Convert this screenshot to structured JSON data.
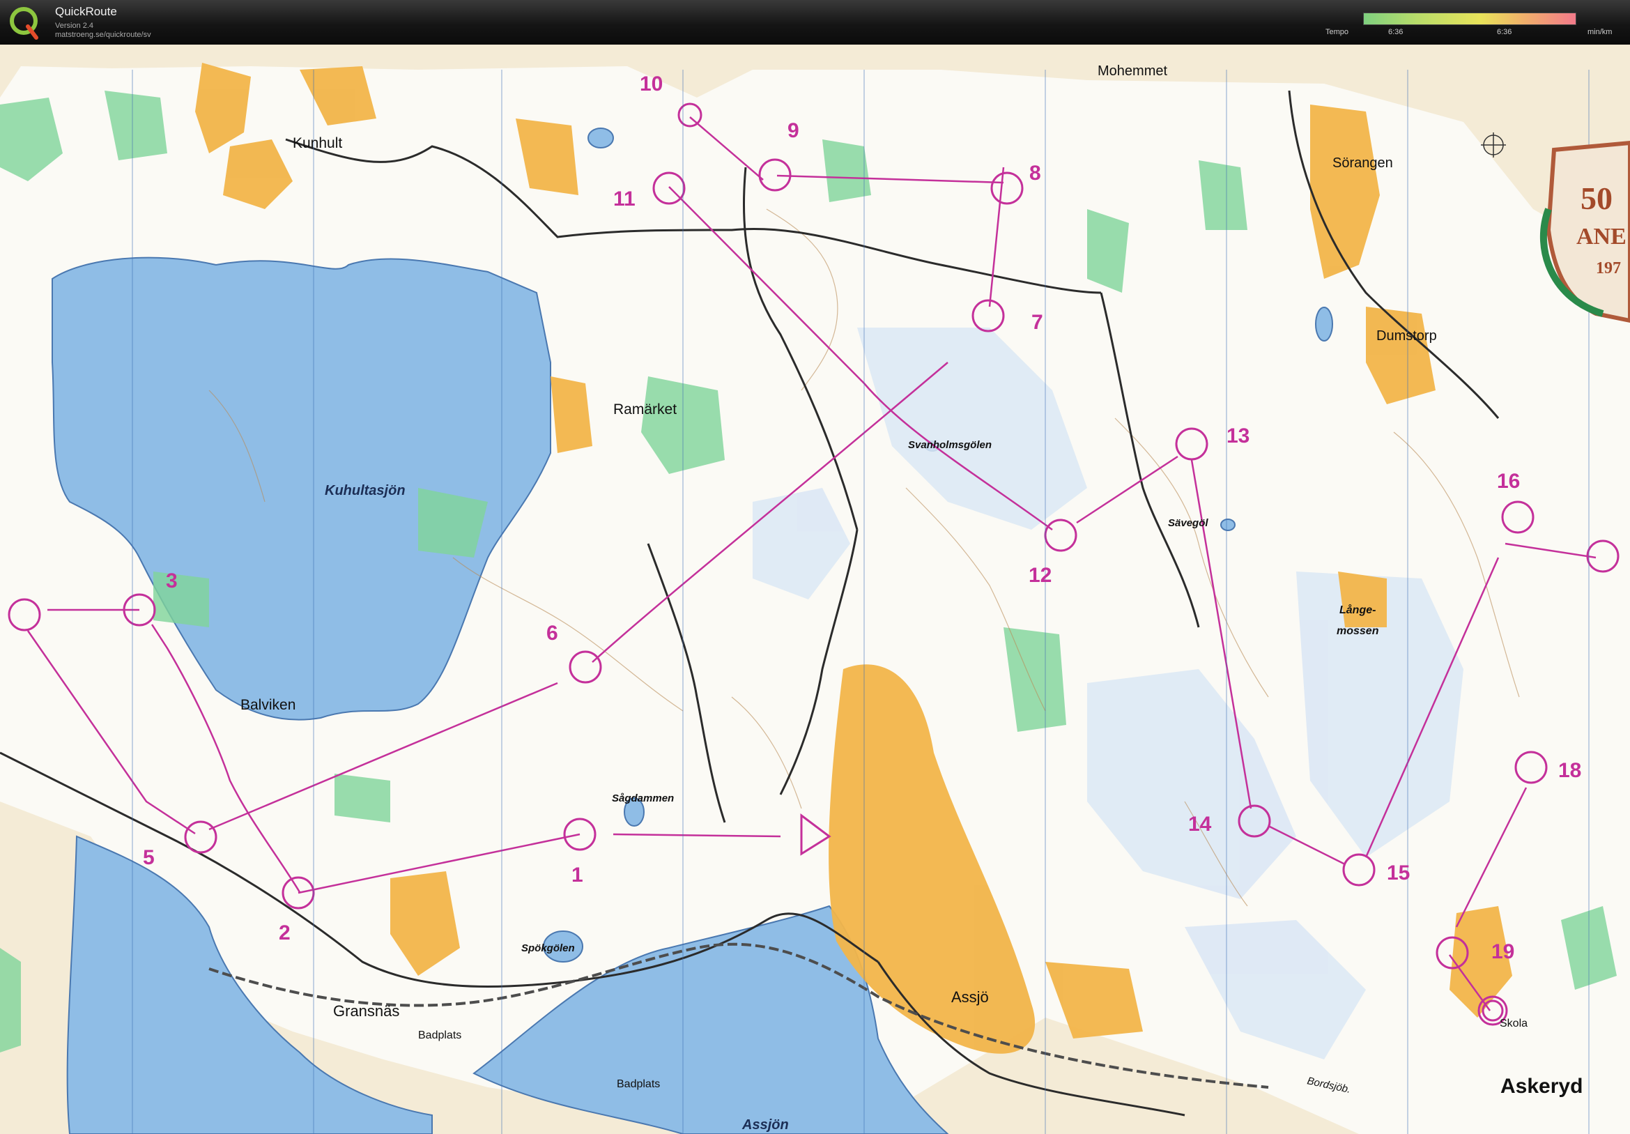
{
  "app": {
    "title": "QuickRoute",
    "version": "Version 2.4",
    "url": "matstroeng.se/quickroute/sv",
    "logo_letter": "Q"
  },
  "tempo": {
    "label": "Tempo",
    "min_value": "6:36",
    "max_value": "6:36",
    "unit": "min/km"
  },
  "map": {
    "place_names": [
      {
        "text": "Mohemmet"
      },
      {
        "text": "Kunhult"
      },
      {
        "text": "Sörangen"
      },
      {
        "text": "Dumstorp"
      },
      {
        "text": "Ramärket"
      },
      {
        "text": "Svanholmsgölen"
      },
      {
        "text": "Kuhultasjön"
      },
      {
        "text": "Sävegöl"
      },
      {
        "text": "Långe-"
      },
      {
        "text": "mossen"
      },
      {
        "text": "Balviken"
      },
      {
        "text": "Sågdammen"
      },
      {
        "text": "Spökgölen"
      },
      {
        "text": "Gransnäs"
      },
      {
        "text": "Badplats"
      },
      {
        "text": "Badplats"
      },
      {
        "text": "Assjö"
      },
      {
        "text": "Assjön"
      },
      {
        "text": "Skola"
      },
      {
        "text": "Askeryd"
      },
      {
        "text": "Bordsjöb."
      }
    ],
    "control_numbers": [
      "1",
      "2",
      "3",
      "5",
      "6",
      "7",
      "8",
      "9",
      "10",
      "11",
      "12",
      "13",
      "14",
      "15",
      "16",
      "18",
      "19"
    ],
    "badge_text": [
      "50",
      "ANE",
      "197"
    ],
    "colors": {
      "course": "#c4309a",
      "water": "#8fbde6",
      "open_land": "#f2b54a",
      "forest_green": "#7fd49a",
      "paper": "#f4ebd6"
    }
  }
}
